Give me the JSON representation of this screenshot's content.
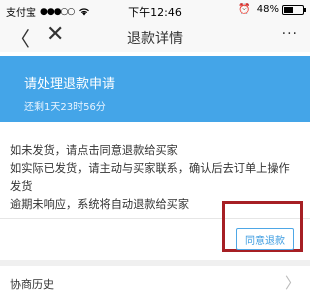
{
  "status_bar": {
    "carrier": "支付宝",
    "signal": "●●●○○",
    "time": "下午12:46",
    "battery_percent": "48%",
    "battery_level": 0.48
  },
  "nav": {
    "title": "退款详情",
    "more": "···"
  },
  "banner": {
    "title": "请处理退款申请",
    "subtitle": "还剩1天23时56分",
    "background": "#44a5e8"
  },
  "instructions": {
    "line1": "如未发货，请点击同意退款给买家",
    "line2": "如实际已发货，请主动与买家联系，确认后去订单上操作",
    "line3": "发货",
    "line4": "逾期未响应，系统将自动退款给买家"
  },
  "actions": {
    "agree_label": "同意退款",
    "highlight_color": "#a61f24"
  },
  "history": {
    "label": "协商历史"
  }
}
